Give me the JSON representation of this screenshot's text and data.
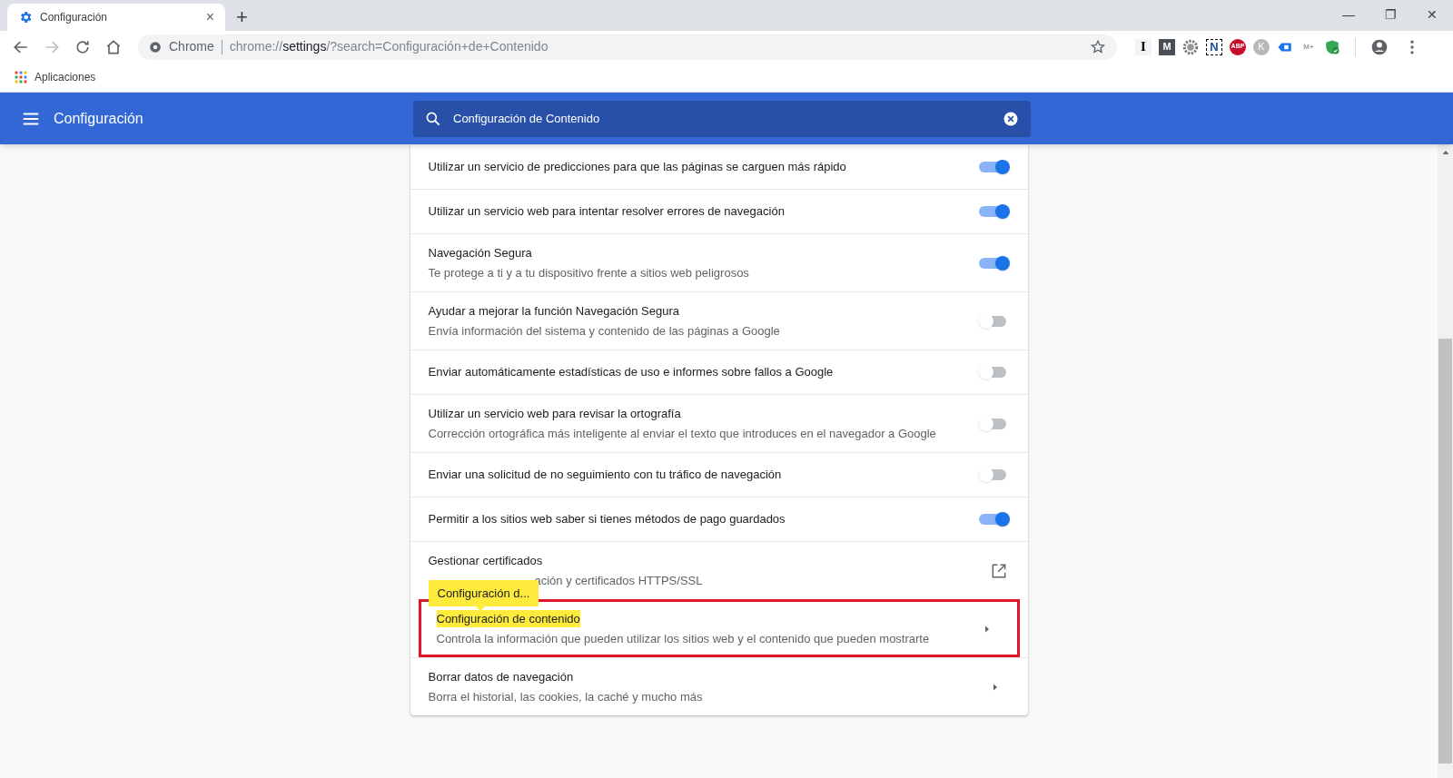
{
  "tab": {
    "title": "Configuración",
    "close": "×",
    "new_tab": "+"
  },
  "window_controls": [
    "—",
    "❐",
    "✕"
  ],
  "address": {
    "site": "Chrome",
    "url_prefix": "chrome://",
    "url_host": "settings",
    "url_rest": "/?search=Configuración+de+Contenido"
  },
  "extensions": [
    {
      "label": "I",
      "kind": "letter"
    },
    {
      "label": "M",
      "kind": "dark"
    },
    {
      "kind": "gear"
    },
    {
      "label": "N",
      "kind": "dashed"
    },
    {
      "label": "ABP",
      "kind": "abp"
    },
    {
      "label": "K",
      "kind": "grey"
    },
    {
      "kind": "tag"
    },
    {
      "label": "M+",
      "kind": "faint"
    },
    {
      "kind": "shield"
    }
  ],
  "bookmarks": [
    {
      "label": "Aplicaciones"
    }
  ],
  "header": {
    "title": "Configuración",
    "search_value": "Configuración de Contenido"
  },
  "rows": [
    {
      "title": "Utilizar un servicio de predicciones para que las páginas se carguen más rápido",
      "kind": "toggle",
      "on": true,
      "highlighted": false
    },
    {
      "title": "Utilizar un servicio web para intentar resolver errores de navegación",
      "kind": "toggle",
      "on": true,
      "highlighted": false
    },
    {
      "title": "Navegación Segura",
      "subtitle": "Te protege a ti y a tu dispositivo frente a sitios web peligrosos",
      "kind": "toggle",
      "on": true,
      "highlighted": false
    },
    {
      "title": "Ayudar a mejorar la función Navegación Segura",
      "subtitle": "Envía información del sistema y contenido de las páginas a Google",
      "kind": "toggle",
      "on": false,
      "highlighted": false
    },
    {
      "title": "Enviar automáticamente estadísticas de uso e informes sobre fallos a Google",
      "kind": "toggle",
      "on": false,
      "highlighted": false
    },
    {
      "title": "Utilizar un servicio web para revisar la ortografía",
      "subtitle": "Corrección ortográfica más inteligente al enviar el texto que introduces en el navegador a Google",
      "kind": "toggle",
      "on": false,
      "highlighted": false
    },
    {
      "title": "Enviar una solicitud de no seguimiento con tu tráfico de navegación",
      "kind": "toggle",
      "on": false,
      "highlighted": false
    },
    {
      "title": "Permitir a los sitios web saber si tienes métodos de pago guardados",
      "kind": "toggle",
      "on": true,
      "highlighted": false
    },
    {
      "title": "Gestionar certificados",
      "subtitle": "ación y certificados HTTPS/SSL",
      "kind": "external",
      "highlighted": false,
      "tooltip": "Configuración d..."
    },
    {
      "title": "Configuración de contenido",
      "subtitle": "Controla la información que pueden utilizar los sitios web y el contenido que pueden mostrarte",
      "kind": "arrow",
      "highlighted": true
    },
    {
      "title": "Borrar datos de navegación",
      "subtitle": "Borra el historial, las cookies, la caché y mucho más",
      "kind": "arrow",
      "highlighted": false
    }
  ]
}
